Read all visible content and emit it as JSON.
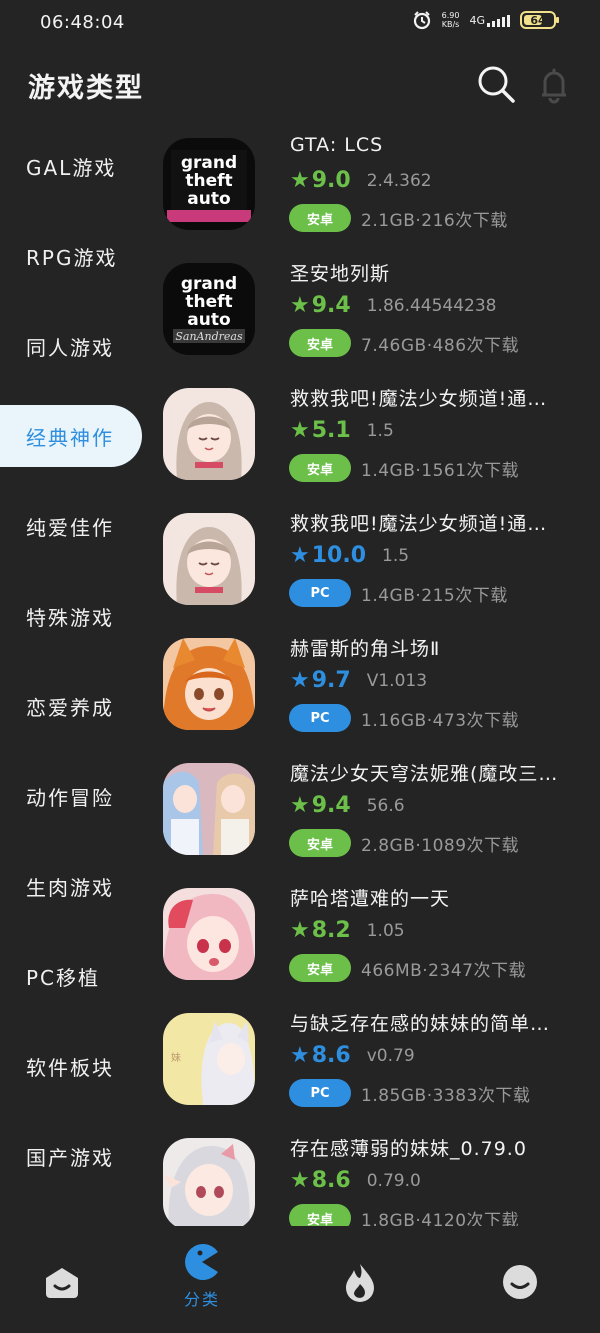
{
  "status_bar": {
    "time": "06:48:04",
    "speed_value": "6.90",
    "speed_unit": "KB/s",
    "network": "4G",
    "battery": "64",
    "battery_level": 0.64
  },
  "header": {
    "title": "游戏类型"
  },
  "sidebar": {
    "items": [
      {
        "label": "GAL游戏"
      },
      {
        "label": "RPG游戏"
      },
      {
        "label": "同人游戏"
      },
      {
        "label": "经典神作"
      },
      {
        "label": "纯爱佳作"
      },
      {
        "label": "特殊游戏"
      },
      {
        "label": "恋爱养成"
      },
      {
        "label": "动作冒险"
      },
      {
        "label": "生肉游戏"
      },
      {
        "label": "PC移植"
      },
      {
        "label": "软件板块"
      },
      {
        "label": "国产游戏"
      }
    ],
    "active_index": 3
  },
  "games": [
    {
      "title": "GTA:  LCS",
      "star": "★",
      "score": "9.0",
      "version": "2.4.362",
      "platform": "安卓",
      "size_downloads": "2.1GB·216次下载",
      "icon": "gta-liberty-city-stories-icon"
    },
    {
      "title": "圣安地列斯",
      "star": "★",
      "score": "9.4",
      "version": "1.86.44544238",
      "platform": "安卓",
      "size_downloads": "7.46GB·486次下载",
      "icon": "gta-san-andreas-icon"
    },
    {
      "title": "救救我吧!魔法少女频道!通…",
      "star": "★",
      "score": "5.1",
      "version": "1.5",
      "platform": "安卓",
      "size_downloads": "1.4GB·1561次下载",
      "icon": "anime-girl-icon"
    },
    {
      "title": "救救我吧!魔法少女频道!通…",
      "star": "★",
      "score": "10.0",
      "version": "1.5",
      "platform": "PC",
      "size_downloads": "1.4GB·215次下载",
      "icon": "anime-girl-icon"
    },
    {
      "title": "赫雷斯的角斗场Ⅱ",
      "star": "★",
      "score": "9.7",
      "version": "V1.013",
      "platform": "PC",
      "size_downloads": "1.16GB·473次下载",
      "icon": "fox-girl-icon"
    },
    {
      "title": "魔法少女天穹法妮雅(魔改三…",
      "star": "★",
      "score": "9.4",
      "version": "56.6",
      "platform": "安卓",
      "size_downloads": "2.8GB·1089次下载",
      "icon": "magical-girls-icon"
    },
    {
      "title": "萨哈塔遭难的一天",
      "star": "★",
      "score": "8.2",
      "version": "1.05",
      "platform": "安卓",
      "size_downloads": "466MB·2347次下载",
      "icon": "pink-hair-girl-icon"
    },
    {
      "title": "与缺乏存在感的妹妹的简单…",
      "star": "★",
      "score": "8.6",
      "version": "v0.79",
      "platform": "PC",
      "size_downloads": "1.85GB·3383次下载",
      "icon": "silver-hair-girl-icon"
    },
    {
      "title": "存在感薄弱的妹妹_0.79.0",
      "star": "★",
      "score": "8.6",
      "version": "0.79.0",
      "platform": "安卓",
      "size_downloads": "1.8GB·4120次下载",
      "icon": "elf-girl-icon"
    }
  ],
  "platform_colors": {
    "安卓": "#6cc04a",
    "PC": "#2e8fe0"
  },
  "score_colors": {
    "安卓": "#6cc04a",
    "PC": "#2e8fe0"
  },
  "bottom_nav": {
    "tabs": [
      {
        "icon": "home-icon",
        "label": ""
      },
      {
        "icon": "category-pacman-icon",
        "label": "分类"
      },
      {
        "icon": "fire-icon",
        "label": ""
      },
      {
        "icon": "profile-face-icon",
        "label": ""
      }
    ],
    "active_index": 1
  },
  "colors": {
    "background": "#242424",
    "accent": "#2e8fe0",
    "active_item_bg": "#e9f4fb"
  }
}
